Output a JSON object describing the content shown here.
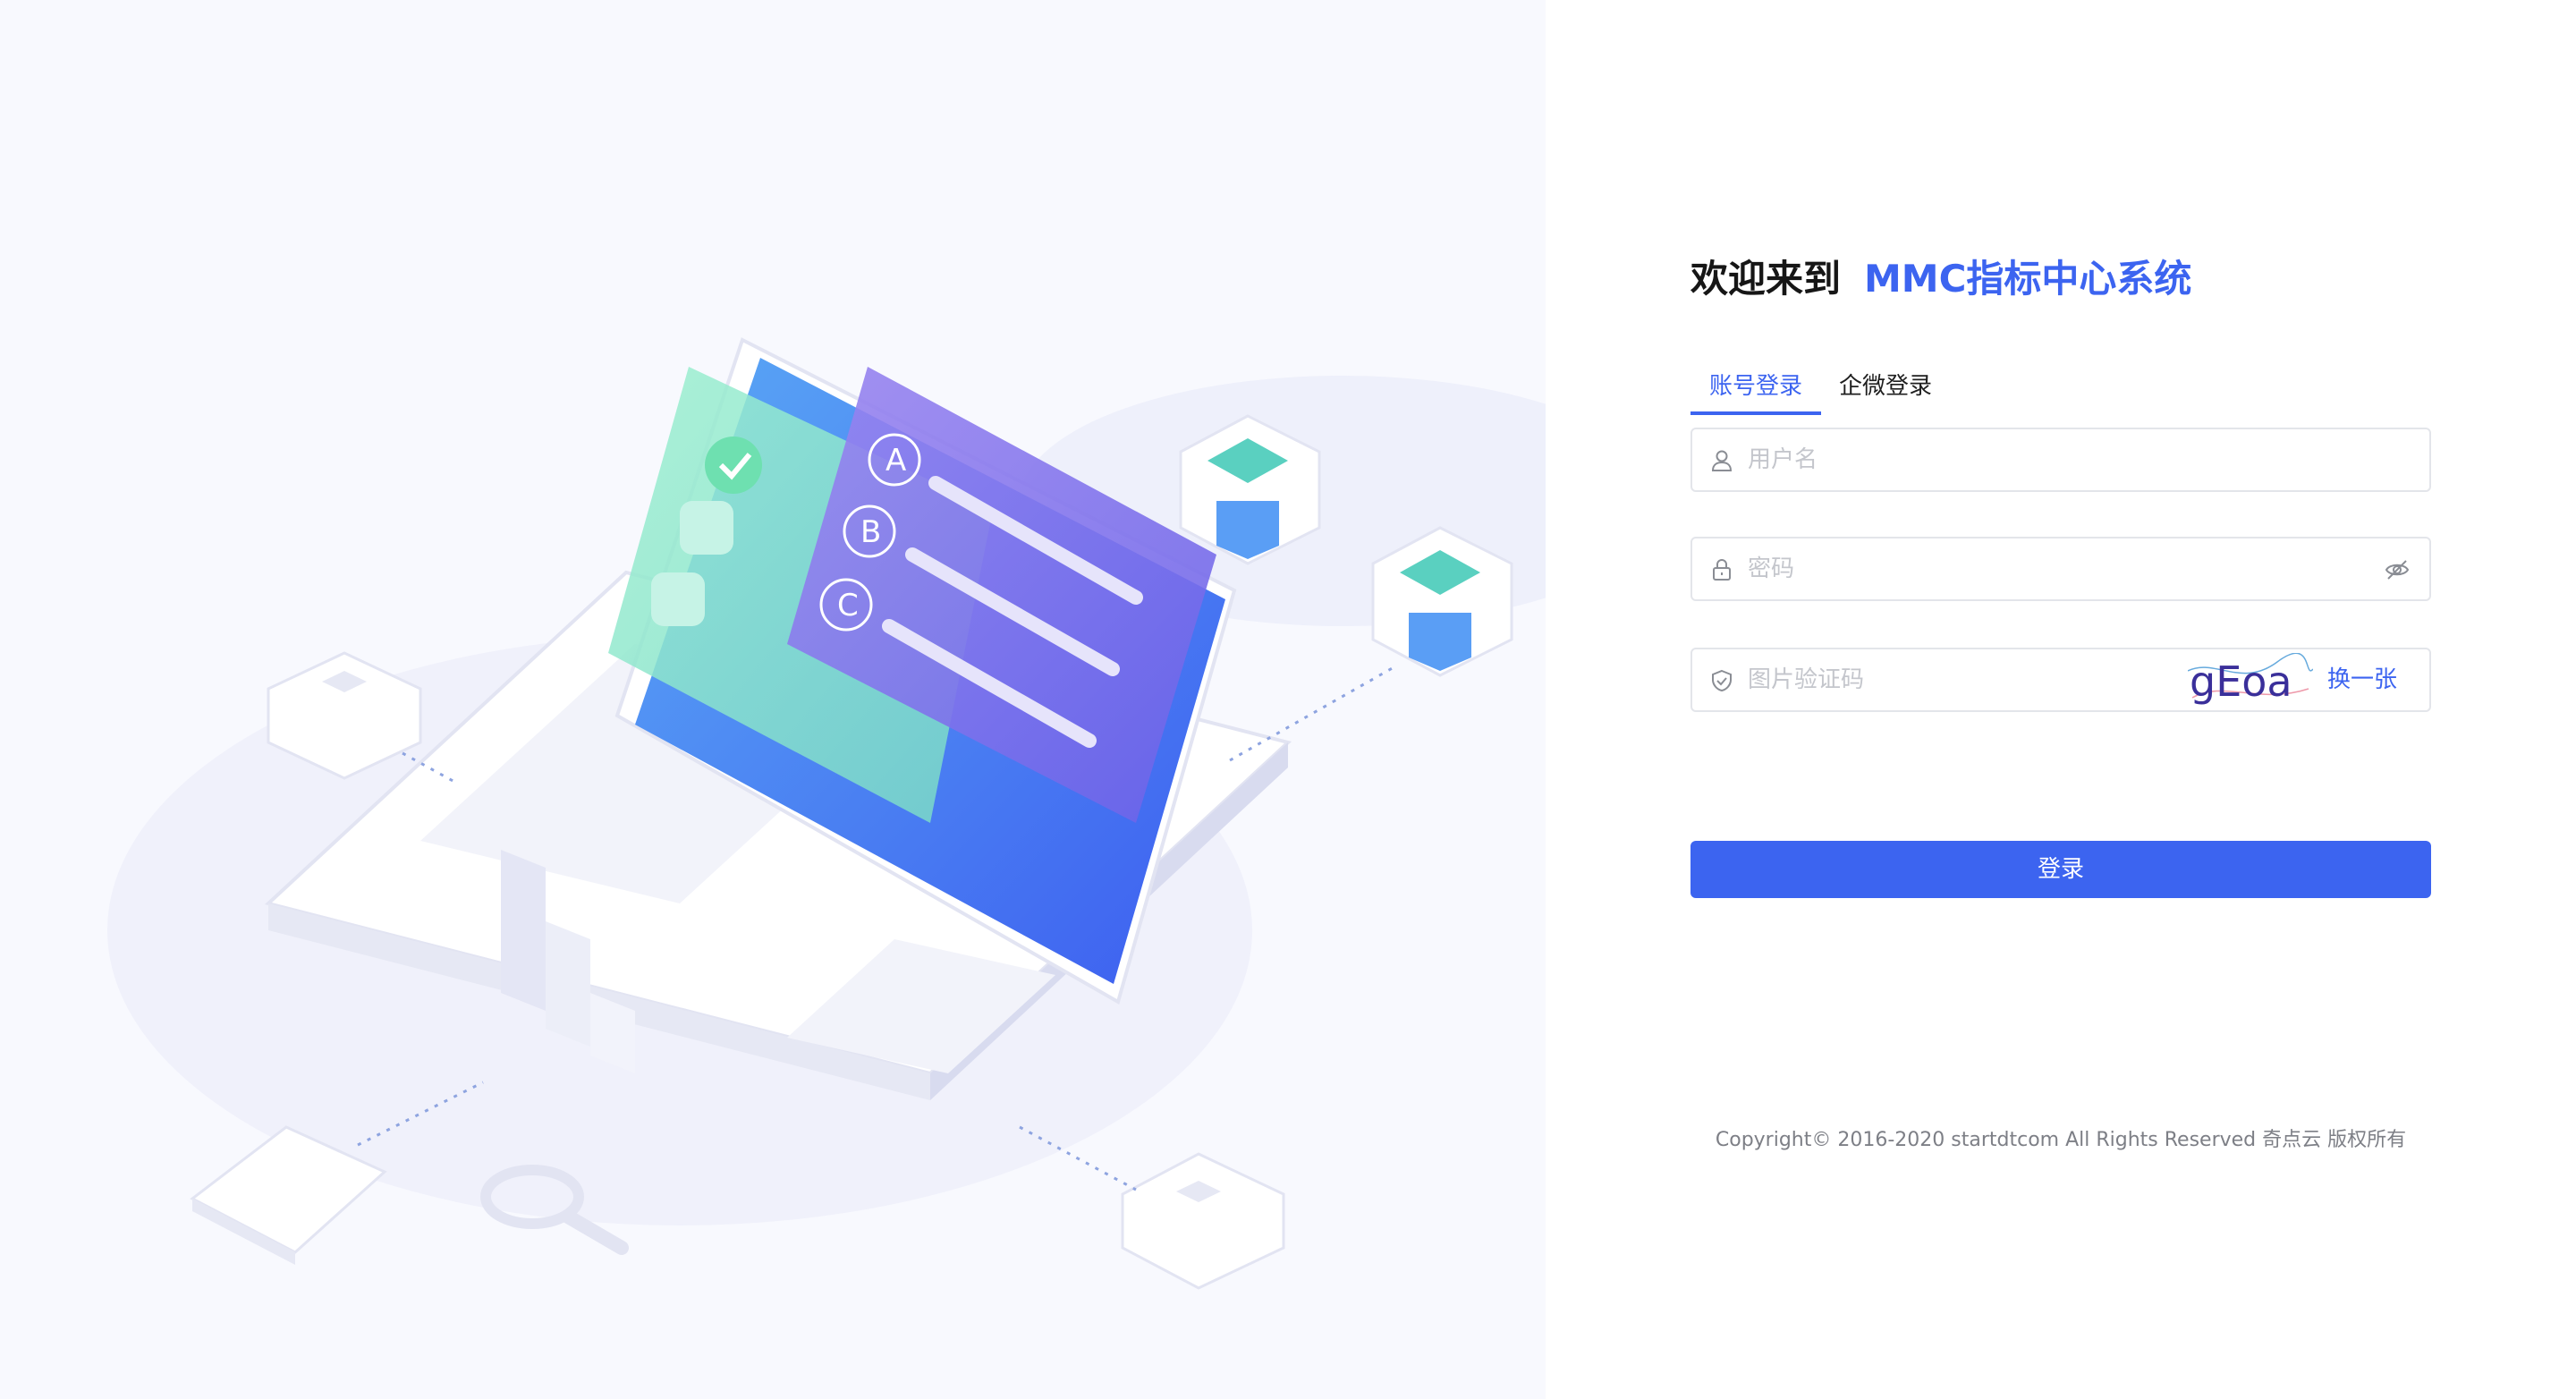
{
  "header": {
    "welcome": "欢迎来到",
    "system_name": "MMC指标中心系统"
  },
  "tabs": [
    {
      "label": "账号登录",
      "active": true
    },
    {
      "label": "企微登录",
      "active": false
    }
  ],
  "form": {
    "username_placeholder": "用户名",
    "password_placeholder": "密码",
    "captcha_placeholder": "图片验证码",
    "captcha_text": "gEoa",
    "refresh_label": "换一张",
    "submit_label": "登录"
  },
  "footer": {
    "copyright": "Copyright© 2016-2020 startdtcom All Rights Reserved 奇点云 版权所有"
  },
  "colors": {
    "accent": "#3c64f0",
    "border": "#e3e5ea",
    "placeholder": "#c4c6cc"
  }
}
